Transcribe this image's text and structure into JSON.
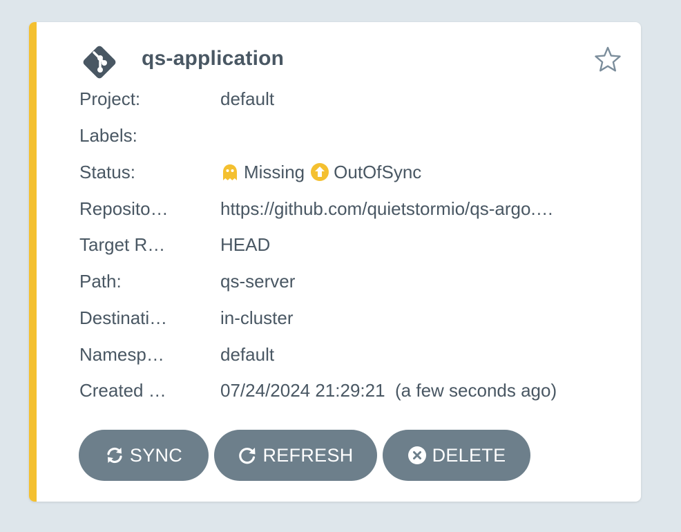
{
  "app": {
    "name": "qs-application",
    "icon": "git-branch-icon",
    "favorite_icon": "star-outline-icon",
    "accent_color": "#f4c030"
  },
  "fields": {
    "project": {
      "label": "Project:",
      "value": "default"
    },
    "labels": {
      "label": "Labels:",
      "value": ""
    },
    "status": {
      "label": "Status:",
      "health": "Missing",
      "health_icon": "ghost-icon",
      "sync": "OutOfSync",
      "sync_icon": "arrow-up-circle-icon",
      "color": "#f4c030"
    },
    "repository": {
      "label": "Reposito…",
      "value": "https://github.com/quietstormio/qs-argo.…"
    },
    "target_revision": {
      "label": "Target R…",
      "value": "HEAD"
    },
    "path": {
      "label": "Path:",
      "value": "qs-server"
    },
    "destination": {
      "label": "Destinati…",
      "value": "in-cluster"
    },
    "namespace": {
      "label": "Namesp…",
      "value": "default"
    },
    "created": {
      "label": "Created …",
      "value": "07/24/2024 21:29:21  (a few seconds ago)"
    }
  },
  "actions": {
    "sync": {
      "label": "SYNC",
      "icon": "sync-icon"
    },
    "refresh": {
      "label": "REFRESH",
      "icon": "refresh-icon"
    },
    "delete": {
      "label": "DELETE",
      "icon": "times-circle-icon"
    }
  }
}
